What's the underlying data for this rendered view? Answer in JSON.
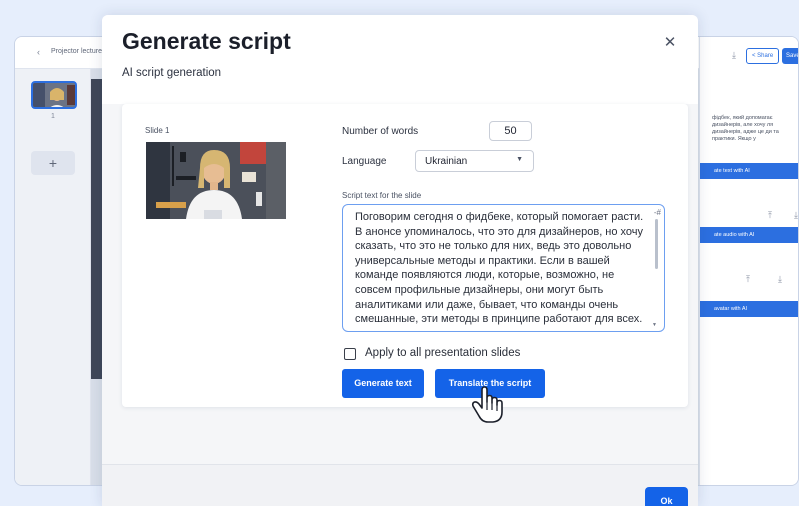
{
  "background_app": {
    "breadcrumb_back": "‹",
    "breadcrumb_title": "Projector lecture",
    "slide_thumbnail_number": "1",
    "add_slide_label": "+",
    "share_label": "< Share",
    "save_label": "Save",
    "right_panel_text": "фідбек, який допомагає дизайнерів, але хочу ля дизайнерів, адже це ди та практики. Якщо у",
    "generate_text_ai_label": "ate text with AI",
    "generate_audio_ai_label": "ate audio with AI",
    "avatar_ai_label": "avatar with AI",
    "accent_color": "#2c6fe0"
  },
  "modal": {
    "title": "Generate script",
    "subtitle": "AI script generation",
    "close_icon": "close-icon",
    "slide_label": "Slide 1",
    "words_label": "Number of words",
    "words_value": "50",
    "language_label": "Language",
    "language_value": "Ukrainian",
    "script_label": "Script text for the slide",
    "script_text": "Поговорим сегодня о фидбеке, который помогает расти. В анонсе упоминалось, что это для дизайнеров, но хочу сказать, что это не только для них, ведь это довольно универсальные методы и практики. Если в вашей команде появляются люди, которые, возможно, не совсем профильные дизайнеры, они могут быть аналитиками или даже, бывает, что команды очень смешанные, эти методы в принципе работают для всех.",
    "apply_label": "Apply to all presentation slides",
    "apply_checked": false,
    "generate_button_label": "Generate text",
    "translate_button_label": "Translate the script",
    "ok_button_label": "Ok",
    "primary_color": "#1463e8"
  }
}
